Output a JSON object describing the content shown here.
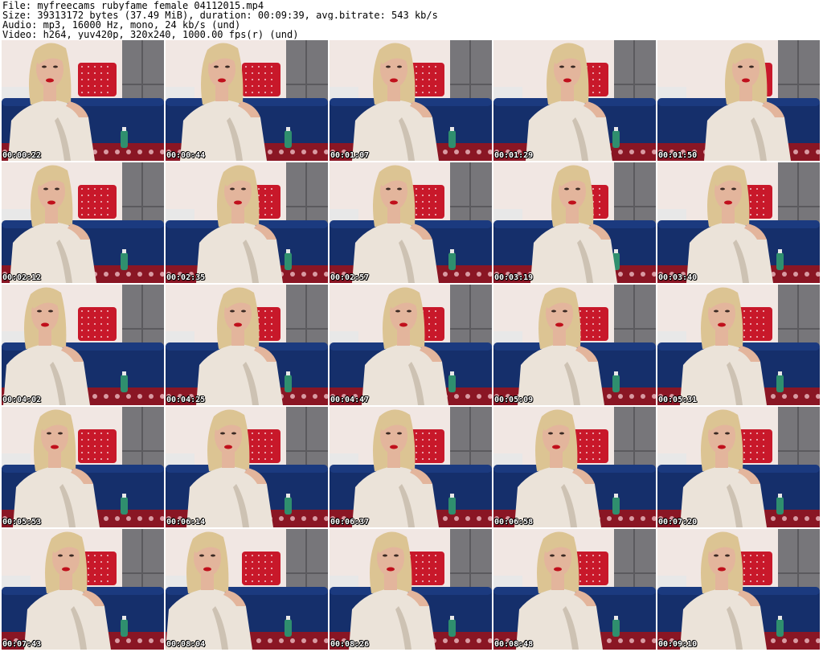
{
  "header": {
    "file_line": "File: myfreecams_rubyfame_female_04112015.mp4",
    "size_line": "Size: 39313172 bytes (37.49 MiB), duration: 00:09:39, avg.bitrate: 543 kb/s",
    "audio_line": "Audio: mp3, 16000 Hz, mono, 24 kb/s (und)",
    "video_line": "Video: h264, yuv420p, 320x240, 1000.00 fps(r) (und)"
  },
  "colors": {
    "wall": "#f1e7e3",
    "cushion_grey": "#77767a",
    "pillow_red": "#c8182a",
    "sofa_blue": "#152f6b",
    "floor_red": "#8a1624",
    "sweater": "#ebe3d9",
    "skin": "#e3b59c",
    "hair": "#dcc493",
    "lips": "#c0101c",
    "check_dark": "#1e1e1e"
  },
  "thumbnails": [
    {
      "timestamp": "00:00:22"
    },
    {
      "timestamp": "00:00:44"
    },
    {
      "timestamp": "00:01:07"
    },
    {
      "timestamp": "00:01:29"
    },
    {
      "timestamp": "00:01:50"
    },
    {
      "timestamp": "00:02:12"
    },
    {
      "timestamp": "00:02:35"
    },
    {
      "timestamp": "00:02:57"
    },
    {
      "timestamp": "00:03:19"
    },
    {
      "timestamp": "00:03:40"
    },
    {
      "timestamp": "00:04:02"
    },
    {
      "timestamp": "00:04:25"
    },
    {
      "timestamp": "00:04:47"
    },
    {
      "timestamp": "00:05:09"
    },
    {
      "timestamp": "00:05:31"
    },
    {
      "timestamp": "00:05:53"
    },
    {
      "timestamp": "00:06:14"
    },
    {
      "timestamp": "00:06:37"
    },
    {
      "timestamp": "00:06:58"
    },
    {
      "timestamp": "00:07:20"
    },
    {
      "timestamp": "00:07:43"
    },
    {
      "timestamp": "00:08:04"
    },
    {
      "timestamp": "00:08:26"
    },
    {
      "timestamp": "00:08:48"
    },
    {
      "timestamp": "00:09:10"
    }
  ]
}
